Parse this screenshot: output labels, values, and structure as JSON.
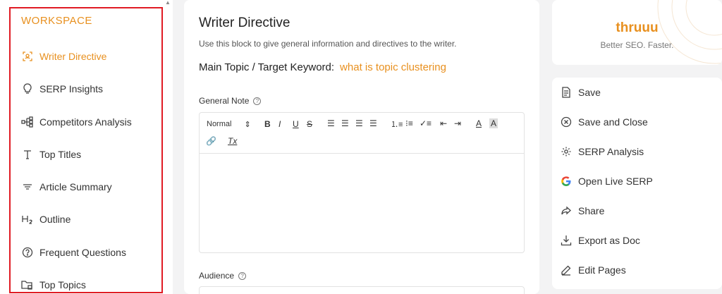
{
  "sidebar": {
    "title": "WORKSPACE",
    "items": [
      {
        "label": "Writer Directive",
        "icon": "writer-directive-icon",
        "active": true
      },
      {
        "label": "SERP Insights",
        "icon": "lightbulb-icon"
      },
      {
        "label": "Competitors Analysis",
        "icon": "hierarchy-icon"
      },
      {
        "label": "Top Titles",
        "icon": "title-t-icon"
      },
      {
        "label": "Article Summary",
        "icon": "filter-lines-icon"
      },
      {
        "label": "Outline",
        "icon": "heading-h2-icon"
      },
      {
        "label": "Frequent Questions",
        "icon": "question-circle-icon"
      },
      {
        "label": "Top Topics",
        "icon": "folder-tag-icon"
      }
    ]
  },
  "main": {
    "title": "Writer Directive",
    "description": "Use this block to give general information and directives to the writer.",
    "keyword_label": "Main Topic / Target Keyword:",
    "keyword_value": "what is topic clustering",
    "general_note_label": "General Note",
    "audience_label": "Audience",
    "toolbar": {
      "format_select": "Normal",
      "buttons": [
        "bold",
        "italic",
        "underline",
        "strike",
        "align-left",
        "align-center",
        "align-right",
        "align-justify",
        "ordered-list",
        "bullet-list",
        "check-list",
        "outdent",
        "indent",
        "text-color",
        "background-color",
        "link",
        "clear-format"
      ]
    }
  },
  "brand": {
    "name": "thruuu",
    "tagline": "Better SEO. Faster."
  },
  "actions": [
    {
      "label": "Save",
      "icon": "document-icon"
    },
    {
      "label": "Save and Close",
      "icon": "close-circle-icon"
    },
    {
      "label": "SERP Analysis",
      "icon": "gear-icon"
    },
    {
      "label": "Open Live SERP",
      "icon": "google-g-icon"
    },
    {
      "label": "Share",
      "icon": "share-arrow-icon"
    },
    {
      "label": "Export as Doc",
      "icon": "download-icon"
    },
    {
      "label": "Edit Pages",
      "icon": "pencil-icon"
    }
  ],
  "colors": {
    "accent": "#e8901f",
    "highlight_border": "#e01b24"
  }
}
